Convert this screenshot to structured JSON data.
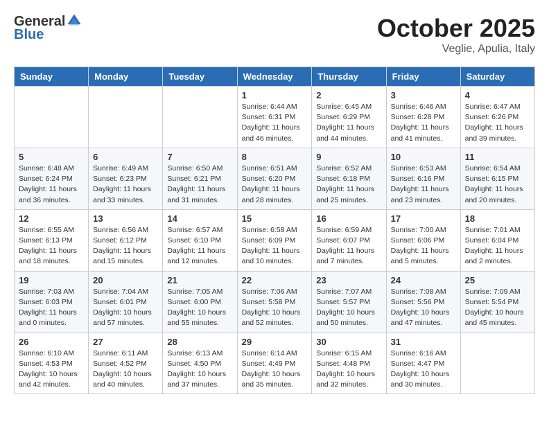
{
  "header": {
    "logo_general": "General",
    "logo_blue": "Blue",
    "month": "October 2025",
    "location": "Veglie, Apulia, Italy"
  },
  "weekdays": [
    "Sunday",
    "Monday",
    "Tuesday",
    "Wednesday",
    "Thursday",
    "Friday",
    "Saturday"
  ],
  "weeks": [
    [
      {
        "day": "",
        "info": ""
      },
      {
        "day": "",
        "info": ""
      },
      {
        "day": "",
        "info": ""
      },
      {
        "day": "1",
        "info": "Sunrise: 6:44 AM\nSunset: 6:31 PM\nDaylight: 11 hours\nand 46 minutes."
      },
      {
        "day": "2",
        "info": "Sunrise: 6:45 AM\nSunset: 6:29 PM\nDaylight: 11 hours\nand 44 minutes."
      },
      {
        "day": "3",
        "info": "Sunrise: 6:46 AM\nSunset: 6:28 PM\nDaylight: 11 hours\nand 41 minutes."
      },
      {
        "day": "4",
        "info": "Sunrise: 6:47 AM\nSunset: 6:26 PM\nDaylight: 11 hours\nand 39 minutes."
      }
    ],
    [
      {
        "day": "5",
        "info": "Sunrise: 6:48 AM\nSunset: 6:24 PM\nDaylight: 11 hours\nand 36 minutes."
      },
      {
        "day": "6",
        "info": "Sunrise: 6:49 AM\nSunset: 6:23 PM\nDaylight: 11 hours\nand 33 minutes."
      },
      {
        "day": "7",
        "info": "Sunrise: 6:50 AM\nSunset: 6:21 PM\nDaylight: 11 hours\nand 31 minutes."
      },
      {
        "day": "8",
        "info": "Sunrise: 6:51 AM\nSunset: 6:20 PM\nDaylight: 11 hours\nand 28 minutes."
      },
      {
        "day": "9",
        "info": "Sunrise: 6:52 AM\nSunset: 6:18 PM\nDaylight: 11 hours\nand 25 minutes."
      },
      {
        "day": "10",
        "info": "Sunrise: 6:53 AM\nSunset: 6:16 PM\nDaylight: 11 hours\nand 23 minutes."
      },
      {
        "day": "11",
        "info": "Sunrise: 6:54 AM\nSunset: 6:15 PM\nDaylight: 11 hours\nand 20 minutes."
      }
    ],
    [
      {
        "day": "12",
        "info": "Sunrise: 6:55 AM\nSunset: 6:13 PM\nDaylight: 11 hours\nand 18 minutes."
      },
      {
        "day": "13",
        "info": "Sunrise: 6:56 AM\nSunset: 6:12 PM\nDaylight: 11 hours\nand 15 minutes."
      },
      {
        "day": "14",
        "info": "Sunrise: 6:57 AM\nSunset: 6:10 PM\nDaylight: 11 hours\nand 12 minutes."
      },
      {
        "day": "15",
        "info": "Sunrise: 6:58 AM\nSunset: 6:09 PM\nDaylight: 11 hours\nand 10 minutes."
      },
      {
        "day": "16",
        "info": "Sunrise: 6:59 AM\nSunset: 6:07 PM\nDaylight: 11 hours\nand 7 minutes."
      },
      {
        "day": "17",
        "info": "Sunrise: 7:00 AM\nSunset: 6:06 PM\nDaylight: 11 hours\nand 5 minutes."
      },
      {
        "day": "18",
        "info": "Sunrise: 7:01 AM\nSunset: 6:04 PM\nDaylight: 11 hours\nand 2 minutes."
      }
    ],
    [
      {
        "day": "19",
        "info": "Sunrise: 7:03 AM\nSunset: 6:03 PM\nDaylight: 11 hours\nand 0 minutes."
      },
      {
        "day": "20",
        "info": "Sunrise: 7:04 AM\nSunset: 6:01 PM\nDaylight: 10 hours\nand 57 minutes."
      },
      {
        "day": "21",
        "info": "Sunrise: 7:05 AM\nSunset: 6:00 PM\nDaylight: 10 hours\nand 55 minutes."
      },
      {
        "day": "22",
        "info": "Sunrise: 7:06 AM\nSunset: 5:58 PM\nDaylight: 10 hours\nand 52 minutes."
      },
      {
        "day": "23",
        "info": "Sunrise: 7:07 AM\nSunset: 5:57 PM\nDaylight: 10 hours\nand 50 minutes."
      },
      {
        "day": "24",
        "info": "Sunrise: 7:08 AM\nSunset: 5:56 PM\nDaylight: 10 hours\nand 47 minutes."
      },
      {
        "day": "25",
        "info": "Sunrise: 7:09 AM\nSunset: 5:54 PM\nDaylight: 10 hours\nand 45 minutes."
      }
    ],
    [
      {
        "day": "26",
        "info": "Sunrise: 6:10 AM\nSunset: 4:53 PM\nDaylight: 10 hours\nand 42 minutes."
      },
      {
        "day": "27",
        "info": "Sunrise: 6:11 AM\nSunset: 4:52 PM\nDaylight: 10 hours\nand 40 minutes."
      },
      {
        "day": "28",
        "info": "Sunrise: 6:13 AM\nSunset: 4:50 PM\nDaylight: 10 hours\nand 37 minutes."
      },
      {
        "day": "29",
        "info": "Sunrise: 6:14 AM\nSunset: 4:49 PM\nDaylight: 10 hours\nand 35 minutes."
      },
      {
        "day": "30",
        "info": "Sunrise: 6:15 AM\nSunset: 4:48 PM\nDaylight: 10 hours\nand 32 minutes."
      },
      {
        "day": "31",
        "info": "Sunrise: 6:16 AM\nSunset: 4:47 PM\nDaylight: 10 hours\nand 30 minutes."
      },
      {
        "day": "",
        "info": ""
      }
    ]
  ]
}
